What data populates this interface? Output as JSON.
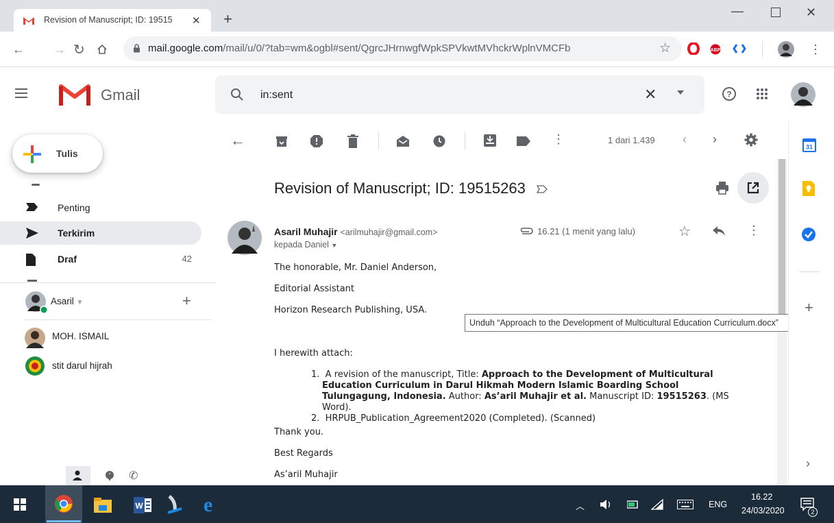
{
  "browser": {
    "tab_title": "Revision of Manuscript; ID: 19515",
    "url_host": "mail.google.com",
    "url_path": "/mail/u/0/?tab=wm&ogbl#sent/QgrcJHrnwgfWpkSPVkwtMVhckrWplnVMCFb"
  },
  "gmail": {
    "brand": "Gmail",
    "search_value": "in:sent",
    "compose_label": "Tulis"
  },
  "nav": {
    "items": [
      {
        "label": "Penting",
        "count": ""
      },
      {
        "label": "Terkirim",
        "count": ""
      },
      {
        "label": "Draf",
        "count": "42"
      }
    ]
  },
  "hangouts": {
    "me": "Asaril",
    "contacts": [
      "MOH. ISMAIL",
      "stit darul hijrah"
    ]
  },
  "toolbar": {
    "pagination": "1 dari 1.439"
  },
  "message": {
    "subject": "Revision of Manuscript; ID: 19515263",
    "sender_name": "Asaril Muhajir",
    "sender_email": "<arilmuhajir@gmail.com>",
    "to": "kepada Daniel",
    "time": "16.21 (1 menit yang lalu)",
    "greeting": "The honorable,  Mr. Daniel Anderson,",
    "line2": "Editorial Assistant",
    "line3": "Horizon Research Publishing, USA.",
    "attach_intro": "I herewith attach:",
    "item1_num": "1.",
    "item1_pre": "A revision of the manuscript, Title: ",
    "item1_title": "Approach to the Development of Multicultural Education Curriculum in Darul Hikmah Modern Islamic Boarding School Tulungagung, Indonesia.",
    "item1_mid": " Author: ",
    "item1_author": "As’aril Muhajir et al.",
    "item1_mid2": " Manuscript ID: ",
    "item1_id": "19515263",
    "item1_post": ". (MS Word).",
    "item2_num": "2.",
    "item2": "HRPUB_Publication_Agreement2020 (Completed). (Scanned)",
    "thanks": "Thank you.",
    "regards": "Best Regards",
    "signature": "As’aril Muhajir"
  },
  "tooltip": "Unduh “Approach to the Development of Multicultural Education Curriculum.docx”",
  "taskbar": {
    "lang": "ENG",
    "time": "16.22",
    "date": "24/03/2020",
    "notif_count": "2"
  }
}
